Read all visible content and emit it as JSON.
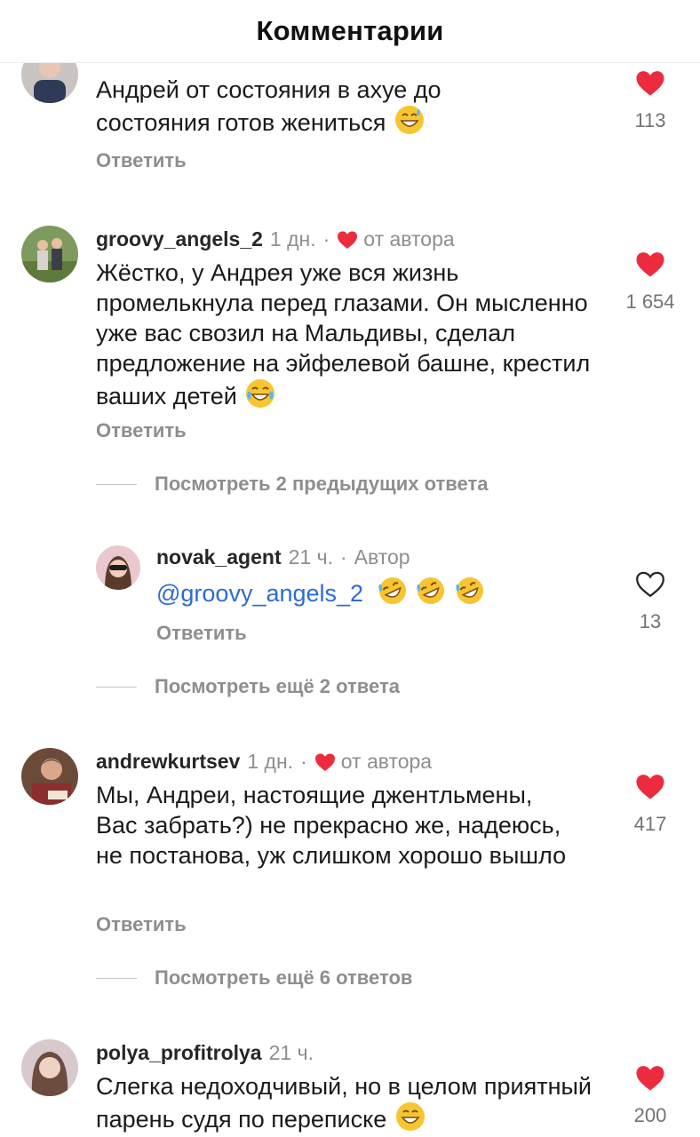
{
  "header": {
    "title": "Комментарии"
  },
  "comments": [
    {
      "username": "",
      "text": "Андрей от состояния в ахуе до состояния готов жениться",
      "emoji": "grinning-sweat-emoji",
      "likes": "113",
      "reply": "Ответить"
    },
    {
      "username": "groovy_angels_2",
      "time": "1 дн.",
      "author_like": "от автора",
      "text": "Жёстко, у Андрея уже вся жизнь промелькнула перед глазами. Он мысленно уже вас свозил на Мальдивы, сделал предложение на эйфелевой башне, крестил ваших детей",
      "emoji": "tears-of-joy-emoji",
      "likes": "1 654",
      "reply": "Ответить",
      "view_replies": "Посмотреть 2 предыдущих ответа"
    },
    {
      "username": "novak_agent",
      "time": "21 ч.",
      "badge": "Автор",
      "mention": "@groovy_angels_2",
      "emoji": "rolling-laughing-emoji",
      "likes": "13",
      "reply": "Ответить",
      "view_replies": "Посмотреть ещё 2 ответа"
    },
    {
      "username": "andrewkurtsev",
      "time": "1 дн.",
      "author_like": "от автора",
      "text": "Мы, Андреи, настоящие джентльмены, Вас забрать?) не прекрасно же, надеюсь, не постанова, уж слишком хорошо вышло",
      "likes": "417",
      "reply": "Ответить",
      "view_replies": "Посмотреть ещё 6 ответов"
    },
    {
      "username": "polya_profitrolya",
      "time": "21 ч.",
      "text": "Слегка недоходчивый, но в целом приятный парень судя по переписке",
      "emoji": "grinning-emoji",
      "likes": "200"
    }
  ],
  "colors": {
    "heart": "#ed2b3f",
    "mention": "#2d6ad6",
    "muted": "#8e8e8e"
  }
}
